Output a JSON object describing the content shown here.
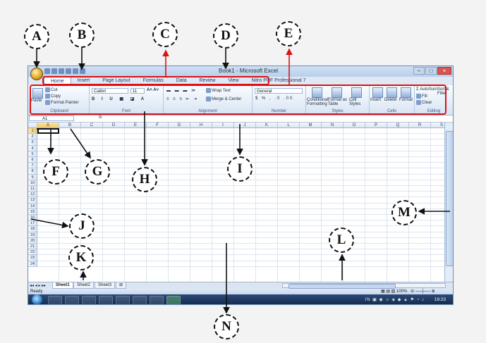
{
  "window": {
    "title": "Book1 - Microsoft Excel"
  },
  "ribbon_tabs": [
    "Home",
    "Insert",
    "Page Layout",
    "Formulas",
    "Data",
    "Review",
    "View",
    "Nitro PDF Professional 7"
  ],
  "clipboard": {
    "paste": "Paste",
    "cut": "Cut",
    "copy": "Copy",
    "format_painter": "Format Painter",
    "label": "Clipboard"
  },
  "font": {
    "name": "Calibri",
    "size": "11",
    "label": "Font"
  },
  "alignment": {
    "wrap_text": "Wrap Text",
    "merge_center": "Merge & Center",
    "label": "Alignment"
  },
  "number": {
    "format": "General",
    "label": "Number"
  },
  "styles": {
    "conditional": "Conditional Formatting",
    "format_table": "Format as Table",
    "cell_styles": "Cell Styles",
    "label": "Styles"
  },
  "cells": {
    "insert": "Insert",
    "delete": "Delete",
    "format": "Format",
    "label": "Cells"
  },
  "editing": {
    "autosum": "AutoSum",
    "fill": "Fill",
    "clear": "Clear",
    "sort_filter": "Sort & Filter",
    "find_select": "Find & Select",
    "label": "Editing"
  },
  "name_box": "A1",
  "fx": "fx",
  "columns": [
    "A",
    "B",
    "C",
    "D",
    "E",
    "F",
    "G",
    "H",
    "I",
    "J",
    "K",
    "L",
    "M",
    "N",
    "O",
    "P",
    "Q",
    "R",
    "S"
  ],
  "rows": [
    "1",
    "2",
    "3",
    "4",
    "5",
    "6",
    "7",
    "8",
    "9",
    "10",
    "11",
    "12",
    "13",
    "14",
    "15",
    "16",
    "17",
    "18",
    "19",
    "20",
    "21",
    "22",
    "23",
    "24"
  ],
  "sheets": [
    "Sheet1",
    "Sheet2",
    "Sheet3"
  ],
  "status": {
    "ready": "Ready",
    "zoom": "100%"
  },
  "clock": "19:23",
  "callouts": [
    "A",
    "B",
    "C",
    "D",
    "E",
    "F",
    "G",
    "H",
    "I",
    "J",
    "K",
    "L",
    "M",
    "N"
  ],
  "colors": {
    "accent": "#d11111",
    "ribbon": "#dfe9f5",
    "taskbar": "#13294a"
  }
}
